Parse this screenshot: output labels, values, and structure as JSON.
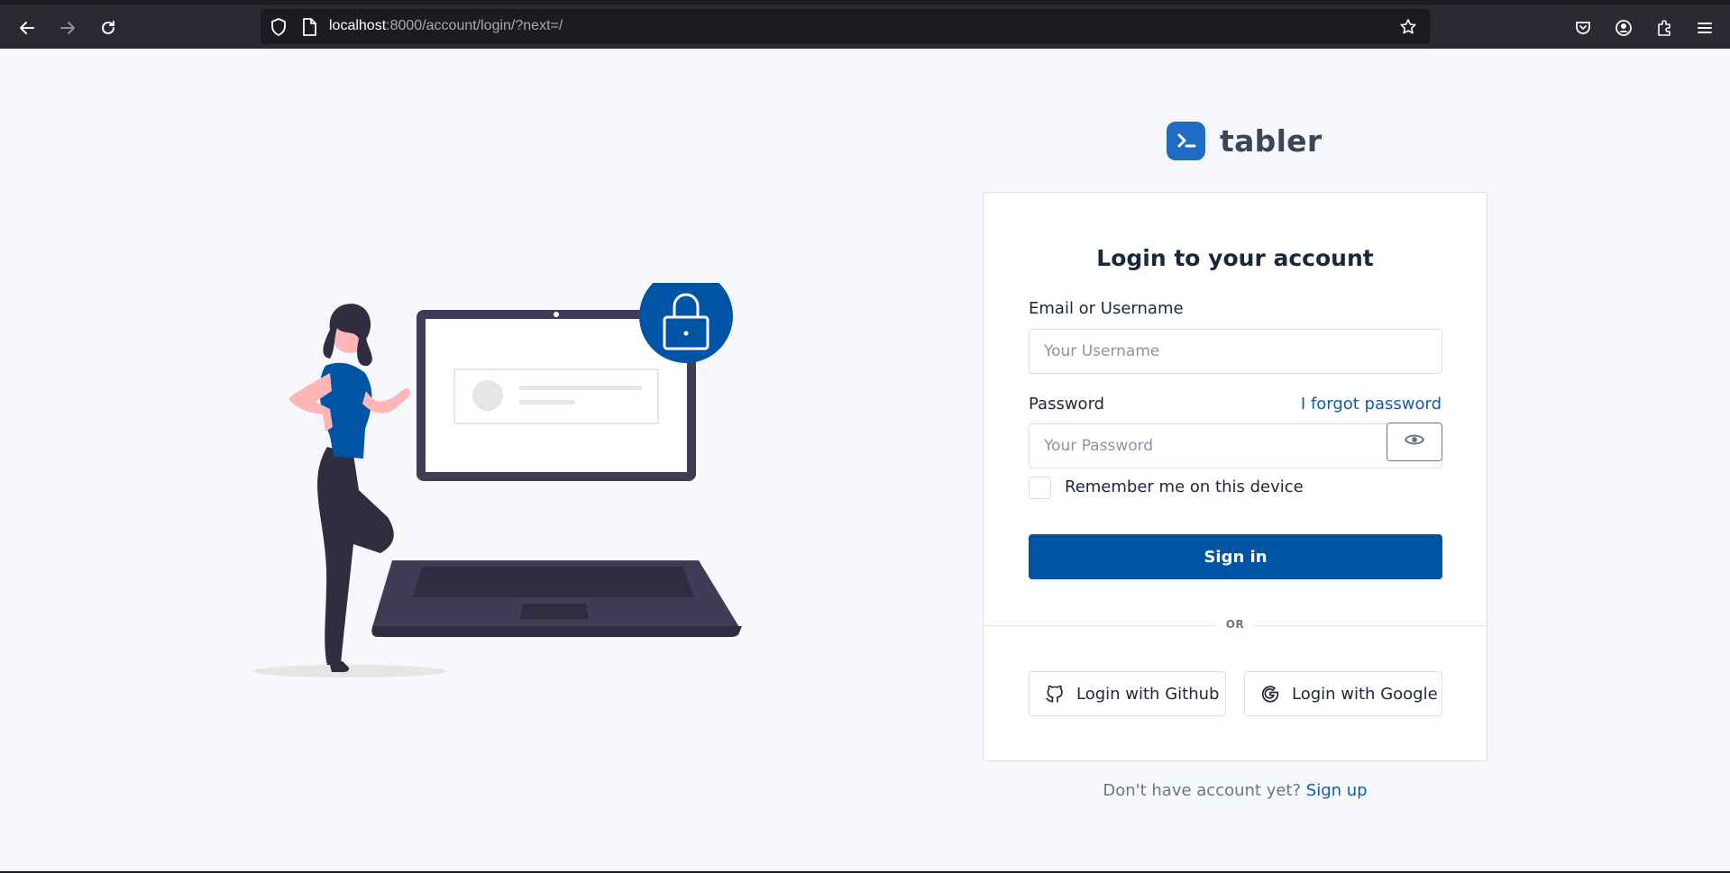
{
  "browser": {
    "url_host": "localhost",
    "url_path": ":8000/account/login/?next=/",
    "icons": [
      "back-icon",
      "forward-icon",
      "reload-icon",
      "shield-icon",
      "page-icon",
      "bookmark-star-icon",
      "pocket-icon",
      "account-icon",
      "extensions-icon",
      "menu-icon"
    ]
  },
  "brand": {
    "name": "tabler",
    "color": "#206bc4"
  },
  "login": {
    "title": "Login to your account",
    "username_label": "Email or Username",
    "username_placeholder": "Your Username",
    "password_label": "Password",
    "forgot_link": "I forgot password",
    "password_placeholder": "Your Password",
    "remember_label": "Remember me on this device",
    "submit_label": "Sign in",
    "divider_text": "OR",
    "github_label": "Login with Github",
    "google_label": "Login with Google"
  },
  "signup": {
    "prompt": "Don't have account yet?",
    "link": "Sign up"
  },
  "colors": {
    "primary": "#0054a6",
    "link": "#0d5db3",
    "page_bg": "#f6f8fb"
  }
}
